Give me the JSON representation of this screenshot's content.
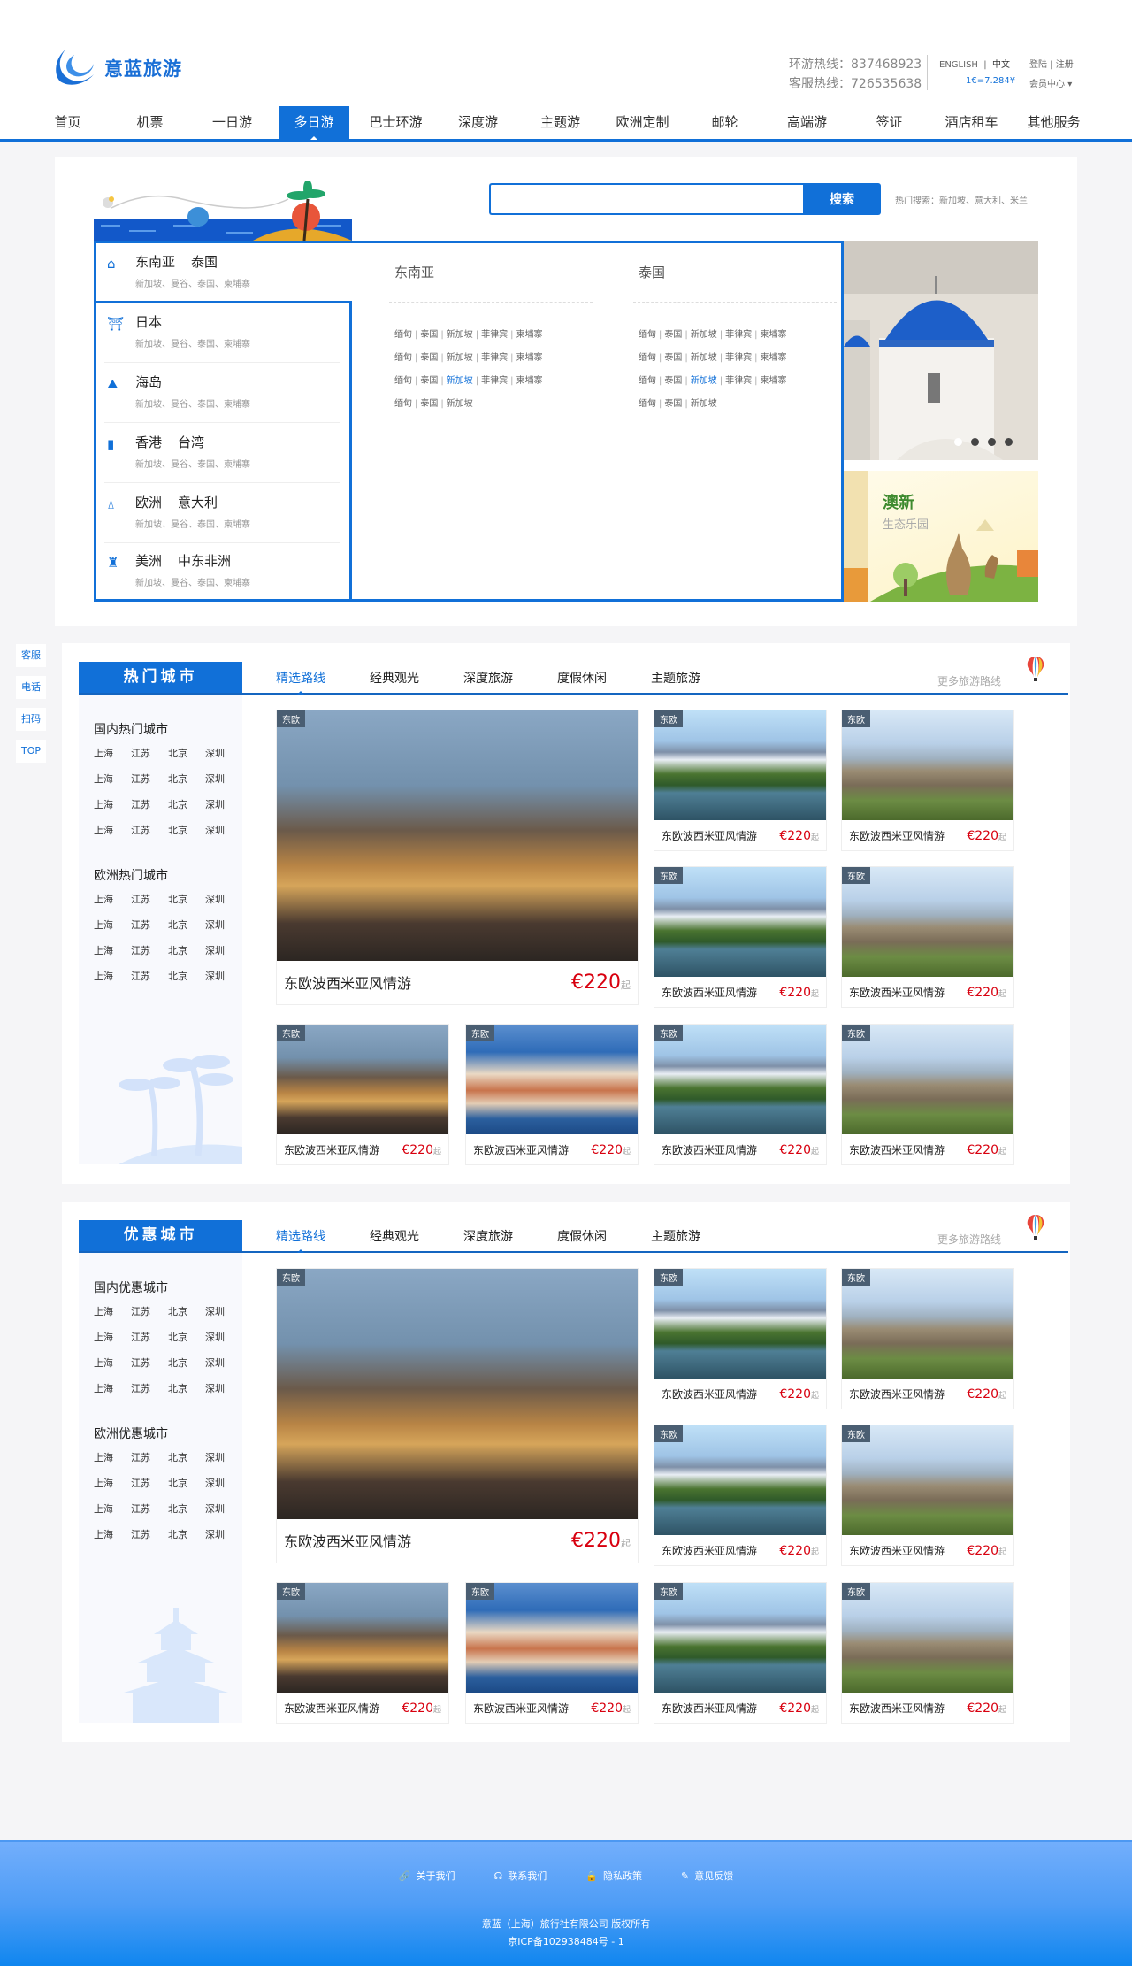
{
  "header": {
    "logo_text": "意蓝旅游",
    "hotline_tour": "环游热线：837468923",
    "hotline_service": "客服热线：726535638",
    "english": "ENGLISH",
    "chinese": "中文",
    "login": "登陆",
    "register": "注册",
    "rate": "1€=7.284¥",
    "member": "会员中心"
  },
  "nav": {
    "active": 3,
    "items": [
      "首页",
      "机票",
      "一日游",
      "多日游",
      "巴士环游",
      "深度游",
      "主题游",
      "欧洲定制",
      "邮轮",
      "高端游",
      "签证",
      "酒店租车",
      "其他服务"
    ]
  },
  "search": {
    "placeholder": "",
    "button": "搜索",
    "hot": "热门搜索：新加坡、意大利、米兰"
  },
  "categories": [
    {
      "icon": "temple-icon",
      "a": "东南亚",
      "b": "泰国",
      "sub": "新加坡、曼谷、泰国、柬埔寨"
    },
    {
      "icon": "torii-icon",
      "a": "日本",
      "b": "",
      "sub": "新加坡、曼谷、泰国、柬埔寨"
    },
    {
      "icon": "island-icon",
      "a": "海岛",
      "b": "",
      "sub": "新加坡、曼谷、泰国、柬埔寨"
    },
    {
      "icon": "tower-icon",
      "a": "香港",
      "b": "台湾",
      "sub": "新加坡、曼谷、泰国、柬埔寨"
    },
    {
      "icon": "eiffel-icon",
      "a": "欧洲",
      "b": "意大利",
      "sub": "新加坡、曼谷、泰国、柬埔寨"
    },
    {
      "icon": "capitol-icon",
      "a": "美洲",
      "b": "中东非洲",
      "sub": "新加坡、曼谷、泰国、柬埔寨"
    }
  ],
  "dropdown": {
    "columns": [
      {
        "title": "东南亚",
        "rows": [
          [
            "缅甸",
            "泰国",
            "新加坡",
            "菲律宾",
            "柬埔寨"
          ],
          [
            "缅甸",
            "泰国",
            "新加坡",
            "菲律宾",
            "柬埔寨"
          ],
          [
            "缅甸",
            "泰国",
            "新加坡",
            "菲律宾",
            "柬埔寨"
          ],
          [
            "缅甸",
            "泰国",
            "新加坡"
          ]
        ]
      },
      {
        "title": "泰国",
        "rows": [
          [
            "缅甸",
            "泰国",
            "新加坡",
            "菲律宾",
            "柬埔寨"
          ],
          [
            "缅甸",
            "泰国",
            "新加坡",
            "菲律宾",
            "柬埔寨"
          ],
          [
            "缅甸",
            "泰国",
            "新加坡",
            "菲律宾",
            "柬埔寨"
          ],
          [
            "缅甸",
            "泰国",
            "新加坡"
          ]
        ]
      }
    ],
    "highlight": {
      "row": 2,
      "item": 2
    }
  },
  "carousel": {
    "count": 4,
    "active": 0
  },
  "promo": {
    "title": "澳新",
    "subtitle": "生态乐园"
  },
  "side_buttons": [
    "客服",
    "电话",
    "扫码",
    "TOP"
  ],
  "sections": [
    {
      "title": "热门城市",
      "tabs": [
        "精选路线",
        "经典观光",
        "深度旅游",
        "度假休闲",
        "主题旅游"
      ],
      "active_tab": 0,
      "more": "更多旅游路线",
      "groups": [
        {
          "title": "国内热门城市",
          "rows": [
            [
              "上海",
              "江苏",
              "北京",
              "深圳"
            ],
            [
              "上海",
              "江苏",
              "北京",
              "深圳"
            ],
            [
              "上海",
              "江苏",
              "北京",
              "深圳"
            ],
            [
              "上海",
              "江苏",
              "北京",
              "深圳"
            ]
          ]
        },
        {
          "title": "欧洲热门城市",
          "rows": [
            [
              "上海",
              "江苏",
              "北京",
              "深圳"
            ],
            [
              "上海",
              "江苏",
              "北京",
              "深圳"
            ],
            [
              "上海",
              "江苏",
              "北京",
              "深圳"
            ],
            [
              "上海",
              "江苏",
              "北京",
              "深圳"
            ]
          ]
        }
      ],
      "featured": {
        "tag": "东欧",
        "name": "东欧波西米亚风情游",
        "price": "€220",
        "suffix": "起",
        "image": "market"
      },
      "cards": [
        {
          "tag": "东欧",
          "name": "东欧波西米亚风情游",
          "price": "€220",
          "suffix": "起",
          "image": "lake"
        },
        {
          "tag": "东欧",
          "name": "东欧波西米亚风情游",
          "price": "€220",
          "suffix": "起",
          "image": "castle"
        },
        {
          "tag": "东欧",
          "name": "东欧波西米亚风情游",
          "price": "€220",
          "suffix": "起",
          "image": "lake"
        },
        {
          "tag": "东欧",
          "name": "东欧波西米亚风情游",
          "price": "€220",
          "suffix": "起",
          "image": "castle"
        },
        {
          "tag": "东欧",
          "name": "东欧波西米亚风情游",
          "price": "€220",
          "suffix": "起",
          "image": "market"
        },
        {
          "tag": "东欧",
          "name": "东欧波西米亚风情游",
          "price": "€220",
          "suffix": "起",
          "image": "coast"
        },
        {
          "tag": "东欧",
          "name": "东欧波西米亚风情游",
          "price": "€220",
          "suffix": "起",
          "image": "lake"
        },
        {
          "tag": "东欧",
          "name": "东欧波西米亚风情游",
          "price": "€220",
          "suffix": "起",
          "image": "castle"
        }
      ]
    },
    {
      "title": "优惠城市",
      "tabs": [
        "精选路线",
        "经典观光",
        "深度旅游",
        "度假休闲",
        "主题旅游"
      ],
      "active_tab": 0,
      "more": "更多旅游路线",
      "groups": [
        {
          "title": "国内优惠城市",
          "rows": [
            [
              "上海",
              "江苏",
              "北京",
              "深圳"
            ],
            [
              "上海",
              "江苏",
              "北京",
              "深圳"
            ],
            [
              "上海",
              "江苏",
              "北京",
              "深圳"
            ],
            [
              "上海",
              "江苏",
              "北京",
              "深圳"
            ]
          ]
        },
        {
          "title": "欧洲优惠城市",
          "rows": [
            [
              "上海",
              "江苏",
              "北京",
              "深圳"
            ],
            [
              "上海",
              "江苏",
              "北京",
              "深圳"
            ],
            [
              "上海",
              "江苏",
              "北京",
              "深圳"
            ],
            [
              "上海",
              "江苏",
              "北京",
              "深圳"
            ]
          ]
        }
      ],
      "featured": {
        "tag": "东欧",
        "name": "东欧波西米亚风情游",
        "price": "€220",
        "suffix": "起",
        "image": "market"
      },
      "cards": [
        {
          "tag": "东欧",
          "name": "东欧波西米亚风情游",
          "price": "€220",
          "suffix": "起",
          "image": "lake"
        },
        {
          "tag": "东欧",
          "name": "东欧波西米亚风情游",
          "price": "€220",
          "suffix": "起",
          "image": "castle"
        },
        {
          "tag": "东欧",
          "name": "东欧波西米亚风情游",
          "price": "€220",
          "suffix": "起",
          "image": "lake"
        },
        {
          "tag": "东欧",
          "name": "东欧波西米亚风情游",
          "price": "€220",
          "suffix": "起",
          "image": "castle"
        },
        {
          "tag": "东欧",
          "name": "东欧波西米亚风情游",
          "price": "€220",
          "suffix": "起",
          "image": "market"
        },
        {
          "tag": "东欧",
          "name": "东欧波西米亚风情游",
          "price": "€220",
          "suffix": "起",
          "image": "coast"
        },
        {
          "tag": "东欧",
          "name": "东欧波西米亚风情游",
          "price": "€220",
          "suffix": "起",
          "image": "lake"
        },
        {
          "tag": "东欧",
          "name": "东欧波西米亚风情游",
          "price": "€220",
          "suffix": "起",
          "image": "castle"
        }
      ]
    }
  ],
  "footer": {
    "links": [
      {
        "icon": "link-icon",
        "label": "关于我们"
      },
      {
        "icon": "headset-icon",
        "label": "联系我们"
      },
      {
        "icon": "lock-icon",
        "label": "隐私政策"
      },
      {
        "icon": "feedback-icon",
        "label": "意见反馈"
      }
    ],
    "copyright": "意蓝（上海）旅行社有限公司 版权所有",
    "icp": "京ICP备102938484号 - 1"
  },
  "colors": {
    "brand": "#1170d8",
    "price": "#d8000f"
  }
}
